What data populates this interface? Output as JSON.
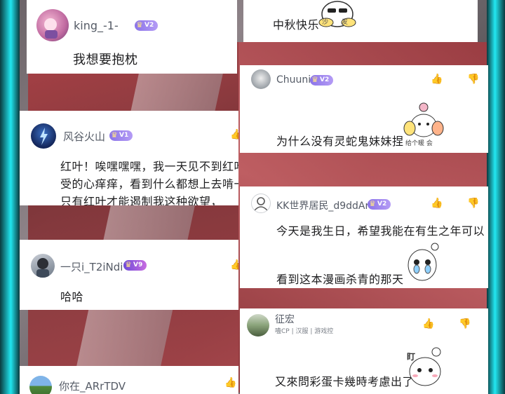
{
  "left_column": [
    {
      "id": "c1",
      "username": "king_-1-",
      "level": "V2",
      "text_lines": [
        "我想要抱枕"
      ]
    },
    {
      "id": "c2",
      "username": "风谷火山",
      "level": "V1",
      "text_lines": [
        "红叶！唉嘿嘿嘿，我一天见不到红叶就难",
        "受的心痒痒，看到什么都想上去啃一口.",
        "只有红叶才能遏制我这种欲望，"
      ]
    },
    {
      "id": "c3",
      "username": "一只i_T2iNdi",
      "level": "V9",
      "text_lines": [
        "哈哈"
      ]
    },
    {
      "id": "c4",
      "username": "你在_ARrTDV",
      "level": "",
      "text_lines": []
    }
  ],
  "right_column": [
    {
      "id": "r0",
      "username": "",
      "level": "",
      "text_lines": [
        "中秋快乐"
      ],
      "sticker_text": "沙 发"
    },
    {
      "id": "r1",
      "username": "Chuuni",
      "level": "V2",
      "text_lines": [
        "为什么没有灵蛇鬼妹妹捏"
      ],
      "sticker_text": "给个暖 会"
    },
    {
      "id": "r2",
      "username": "KK世界居民_d9ddAr",
      "level": "V2",
      "text_lines": [
        "今天是我生日，希望我能在有生之年可以",
        "看到这本漫画杀青的那天"
      ]
    },
    {
      "id": "r3",
      "username": "征宏",
      "level": "",
      "subtitle": "嗑CP | 汉服 | 游戏控",
      "text_lines": [
        "又來問彩蛋卡幾時考慮出了"
      ],
      "sticker_text": "盯"
    }
  ],
  "icons": {
    "like": "thumbs-up-icon",
    "dislike": "thumbs-down-icon"
  },
  "colors": {
    "frame_cyan": "#22e8f2",
    "badge_purple": "#8b74e8",
    "text": "#1d1d1f",
    "username": "#555b66"
  }
}
